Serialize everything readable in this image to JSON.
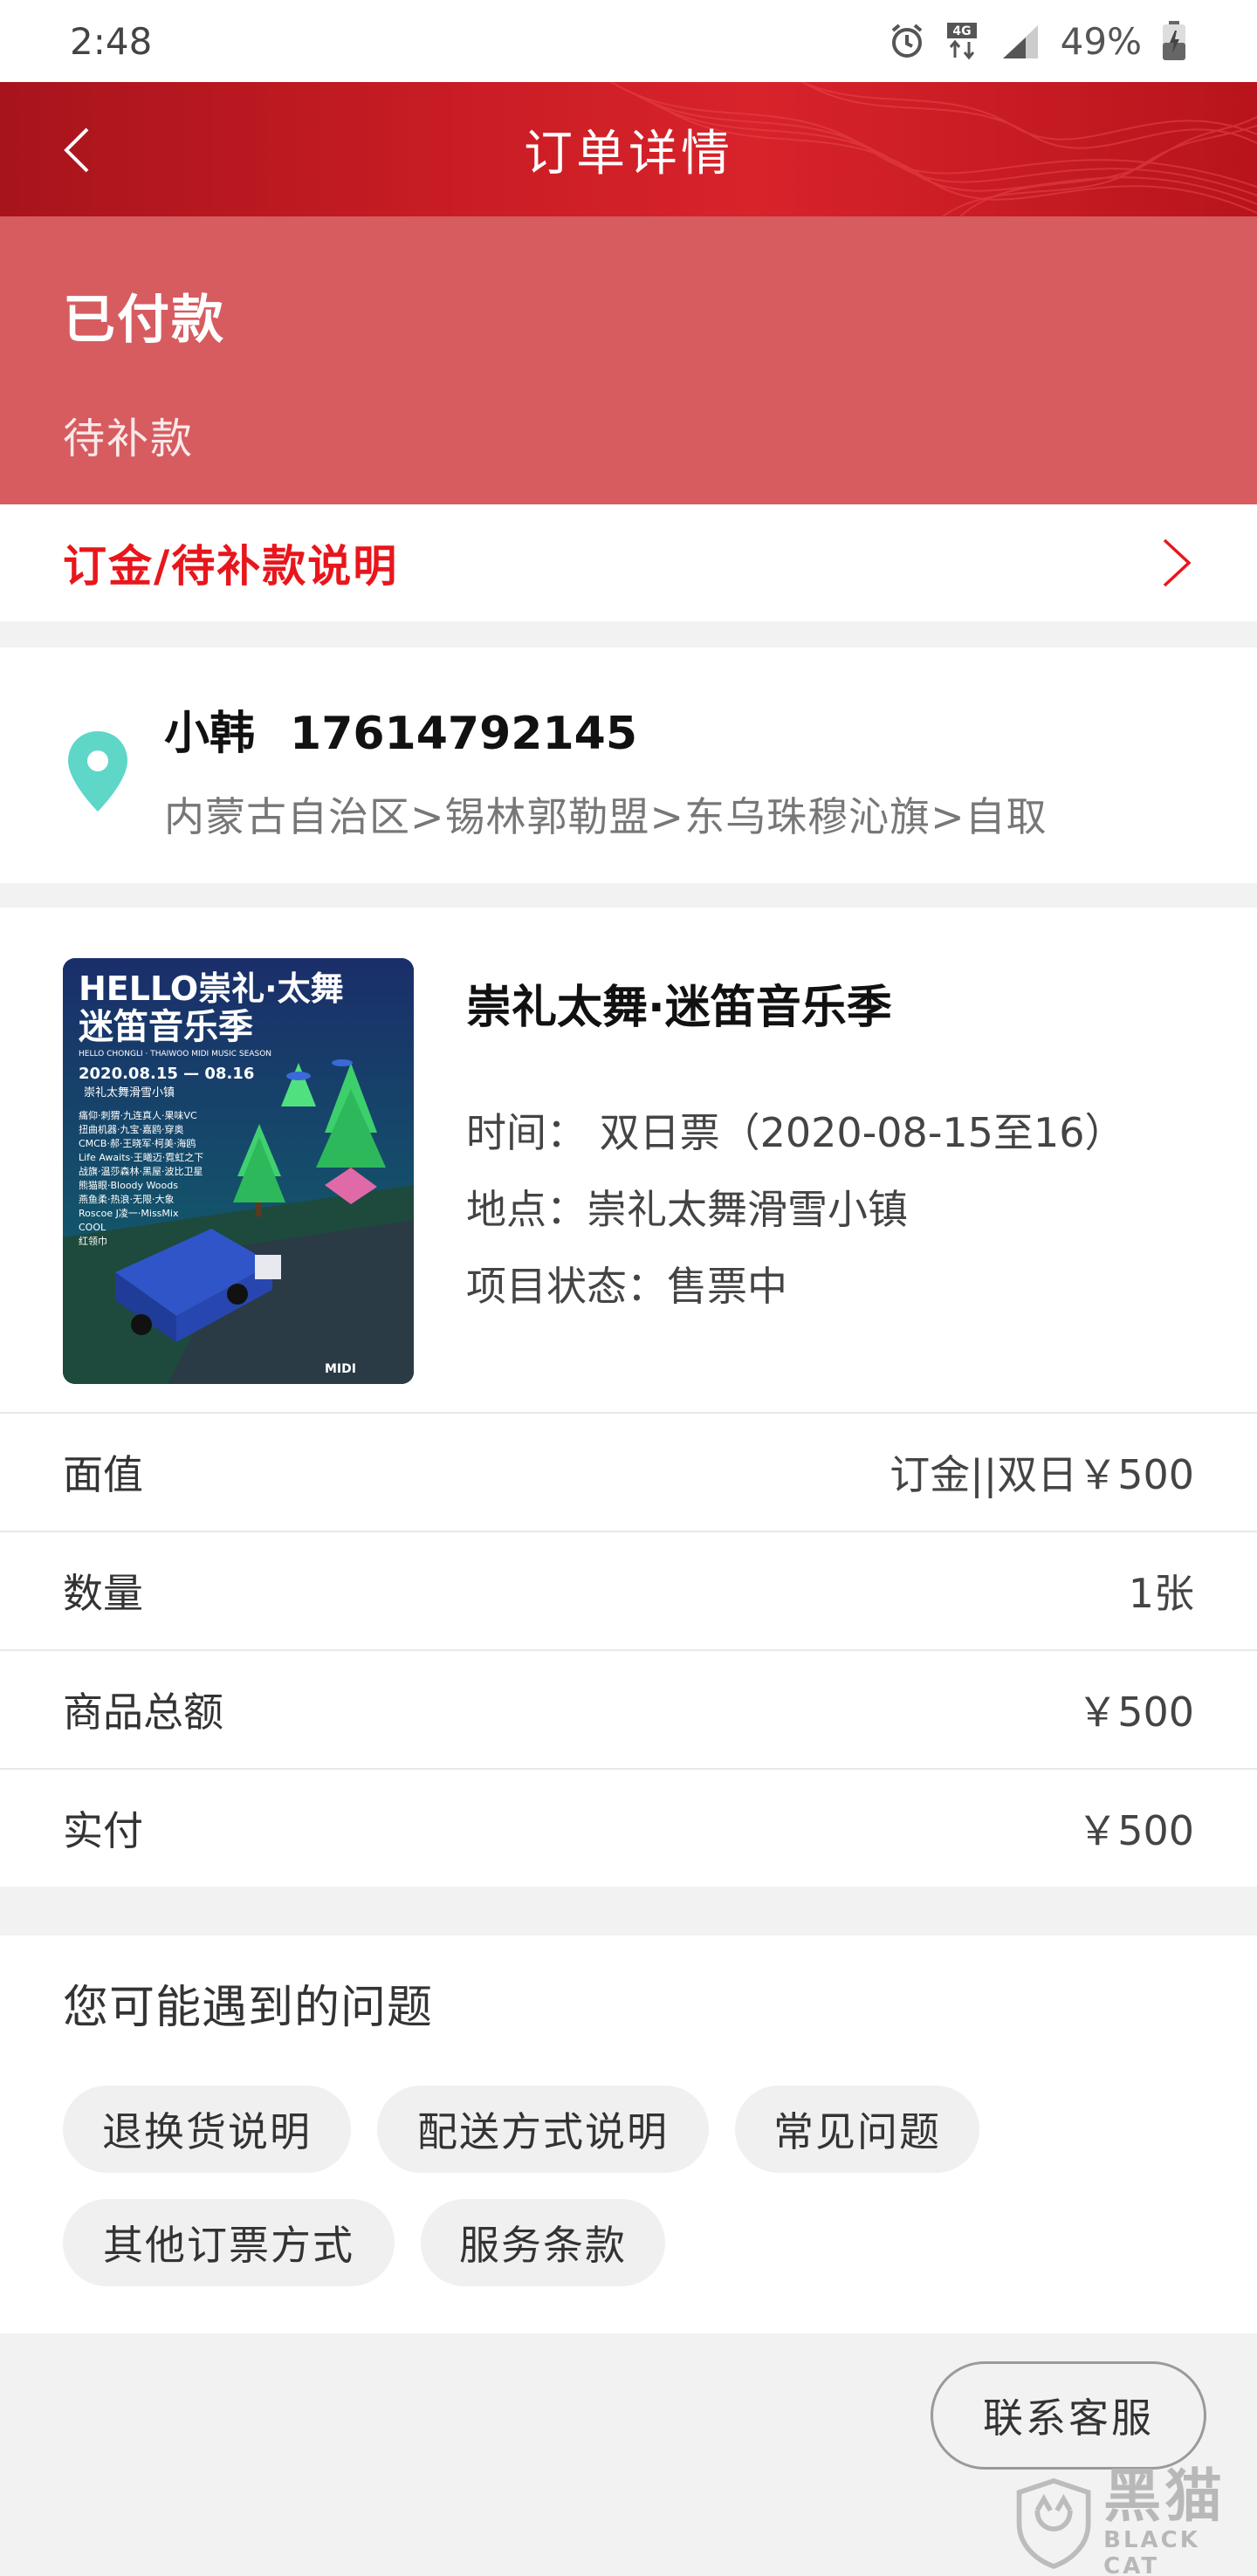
{
  "status_bar": {
    "time": "2:48",
    "network": "4G",
    "battery": "49%"
  },
  "header": {
    "title": "订单详情"
  },
  "order_status": {
    "main": "已付款",
    "sub": "待补款"
  },
  "deposit_link": {
    "label": "订金/待补款说明"
  },
  "address": {
    "name": "小韩",
    "phone": "17614792145",
    "detail": "内蒙古自治区>锡林郭勒盟>东乌珠穆沁旗>自取"
  },
  "product": {
    "title": "崇礼太舞·迷笛音乐季",
    "time": "时间： 双日票（2020-08-15至16）",
    "venue": "地点：崇礼太舞滑雪小镇",
    "project_status": "项目状态：售票中",
    "poster": {
      "headline": "HELLO崇礼·太舞",
      "subhead": "迷笛音乐季",
      "english": "HELLO CHONGLI · THAIWOO MIDI MUSIC SEASON",
      "dates": "2020.08.15 — 08.16",
      "location": "崇礼太舞滑雪小镇",
      "lineup": [
        "痛仰·刺猬·九连真人·果味VC",
        "扭曲机器·九宝·嘉鸥·穿奥",
        "CMCB·郝·王晓军·柯美·海鸥",
        "Life Awaits·王曦迈·霓虹之下",
        "战旗·温莎森林·黑屋·波比卫星",
        "熊猫眼·Bloody Woods",
        "燕鱼柔·热浪·无限·大象",
        "Roscoe J凌一·MissMix",
        "COOL",
        "红领巾"
      ],
      "brand": "MIDI"
    }
  },
  "details": [
    {
      "label": "面值",
      "value": "订金||双日￥500"
    },
    {
      "label": "数量",
      "value": "1张"
    },
    {
      "label": "商品总额",
      "value": "￥500"
    },
    {
      "label": "实付",
      "value": "￥500"
    }
  ],
  "faq": {
    "title": "您可能遇到的问题",
    "chips": [
      "退换货说明",
      "配送方式说明",
      "常见问题",
      "其他订票方式",
      "服务条款"
    ]
  },
  "contact": {
    "label": "联系客服"
  },
  "watermark": {
    "cn": "黑猫",
    "en": "BLACK CAT"
  },
  "colors": {
    "header_red": "#c81c24",
    "status_panel": "#d65c60",
    "accent_red": "#e8161c",
    "pin_teal": "#5ed6c8"
  }
}
